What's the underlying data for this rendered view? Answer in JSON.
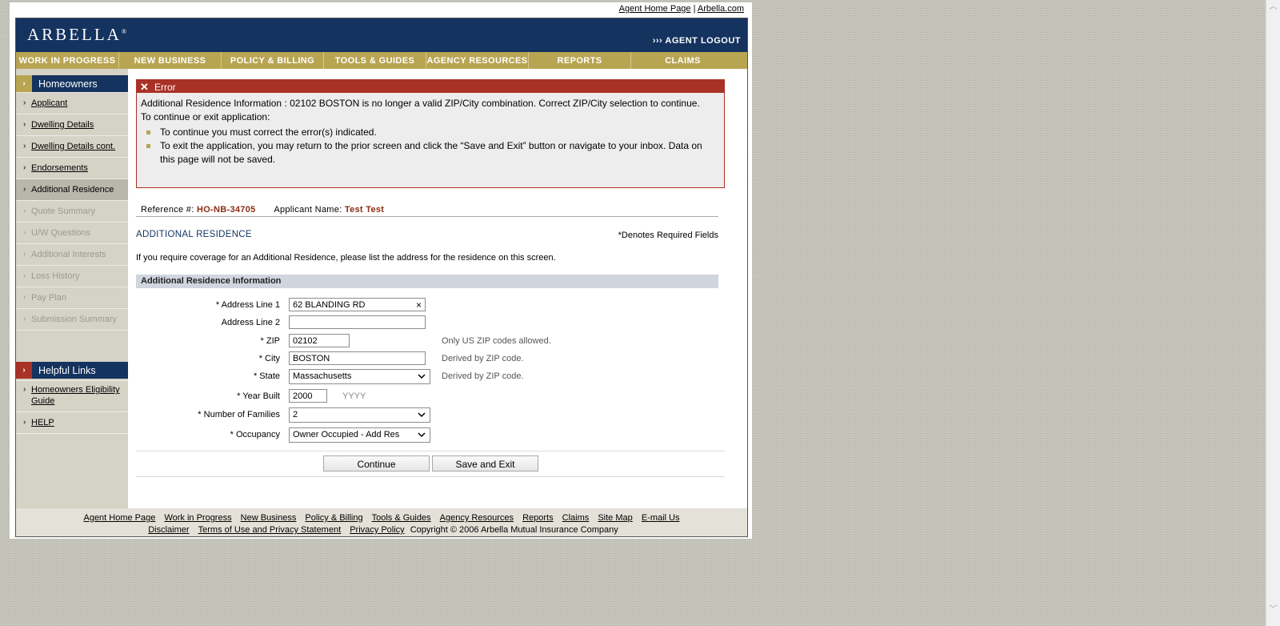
{
  "top_links": {
    "agent_home": "Agent Home Page",
    "separator": "|",
    "arbella": "Arbella.com"
  },
  "header": {
    "logo": "ARBELLA",
    "logo_mark": "®",
    "logout_prefix": "›››",
    "logout": "AGENT LOGOUT"
  },
  "nav": [
    "WORK IN PROGRESS",
    "NEW BUSINESS",
    "POLICY & BILLING",
    "TOOLS & GUIDES",
    "AGENCY RESOURCES",
    "REPORTS",
    "CLAIMS"
  ],
  "sidebar": {
    "section_title": "Homeowners",
    "items": [
      {
        "label": "Applicant",
        "state": "link"
      },
      {
        "label": "Dwelling Details",
        "state": "link"
      },
      {
        "label": "Dwelling Details cont.",
        "state": "link"
      },
      {
        "label": "Endorsements",
        "state": "link"
      },
      {
        "label": "Additional Residence",
        "state": "current"
      },
      {
        "label": "Quote Summary",
        "state": "disabled"
      },
      {
        "label": "U/W Questions",
        "state": "disabled"
      },
      {
        "label": "Additional Interests",
        "state": "disabled"
      },
      {
        "label": "Loss History",
        "state": "disabled"
      },
      {
        "label": "Pay Plan",
        "state": "disabled"
      },
      {
        "label": "Submission Summary",
        "state": "disabled"
      }
    ],
    "helpful_title": "Helpful Links",
    "helpful_items": [
      "Homeowners Eligibility Guide",
      "HELP"
    ]
  },
  "error": {
    "title": "Error",
    "message": "Additional Residence Information : 02102 BOSTON is no longer a valid ZIP/City combination. Correct ZIP/City selection to continue.",
    "subtitle": "To continue or exit application:",
    "bullets": [
      "To continue you must correct the error(s) indicated.",
      "To exit the application, you may return to the prior screen and click the “Save and Exit” button or navigate to your inbox. Data on this page will not be saved."
    ]
  },
  "reference": {
    "ref_label": "Reference #:",
    "ref_value": "HO-NB-34705",
    "name_label": "Applicant Name:",
    "name_value": "Test Test"
  },
  "section": {
    "title": "ADDITIONAL RESIDENCE",
    "required_note": "*Denotes Required Fields",
    "intro": "If you require coverage for an Additional Residence, please list the address for the residence on this screen.",
    "band": "Additional Residence Information"
  },
  "form": {
    "address1": {
      "label": "* Address Line 1",
      "value": "62 BLANDING RD",
      "clear": "×"
    },
    "address2": {
      "label": "Address Line 2",
      "value": ""
    },
    "zip": {
      "label": "* ZIP",
      "value": "02102",
      "hint": "Only US ZIP codes allowed."
    },
    "city": {
      "label": "* City",
      "value": "BOSTON",
      "hint": "Derived by ZIP code."
    },
    "state": {
      "label": "* State",
      "value": "Massachusetts",
      "hint": "Derived by ZIP code."
    },
    "year_built": {
      "label": "* Year Built",
      "value": "2000",
      "hint": "YYYY"
    },
    "families": {
      "label": "* Number of Families",
      "value": "2"
    },
    "occupancy": {
      "label": "* Occupancy",
      "value": "Owner Occupied - Add Res"
    }
  },
  "buttons": {
    "continue": "Continue",
    "save_exit": "Save and Exit"
  },
  "footer": {
    "row1": [
      "Agent Home Page",
      "Work in Progress",
      "New Business",
      "Policy & Billing",
      "Tools & Guides",
      "Agency Resources",
      "Reports",
      "Claims",
      "Site Map",
      "E-mail Us"
    ],
    "row2": [
      "Disclaimer",
      "Terms of Use and Privacy Statement",
      "Privacy Policy"
    ],
    "copyright": "Copyright © 2006 Arbella Mutual Insurance Company"
  }
}
